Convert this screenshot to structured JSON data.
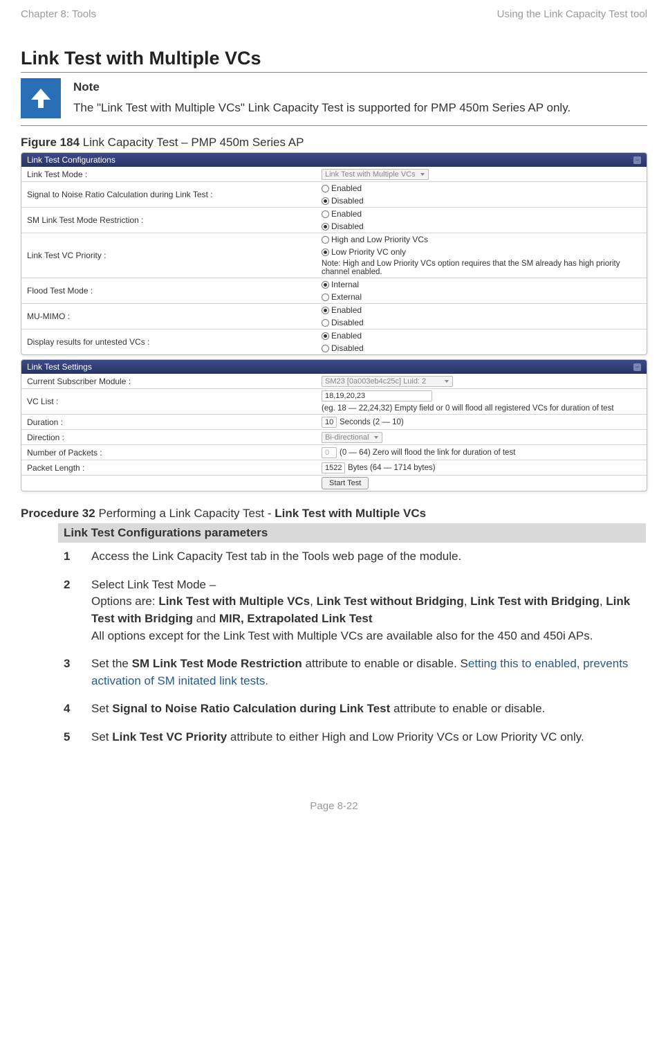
{
  "header": {
    "left": "Chapter 8:  Tools",
    "right": "Using the Link Capacity Test tool"
  },
  "main_heading": "Link Test with Multiple VCs",
  "note": {
    "label": "Note",
    "text": "The \"Link Test with Multiple VCs\" Link Capacity Test is supported for PMP 450m Series AP only."
  },
  "figure": {
    "label": "Figure 184",
    "text": " Link Capacity Test – PMP 450m Series AP"
  },
  "panels": {
    "config_title": "Link Test Configurations",
    "settings_title": "Link Test Settings",
    "config": {
      "link_test_mode_lbl": "Link Test Mode :",
      "link_test_mode_val": "Link Test with Multiple VCs",
      "snr_lbl": "Signal to Noise Ratio Calculation during Link Test :",
      "snr_en": "Enabled",
      "snr_dis": "Disabled",
      "sm_restrict_lbl": "SM Link Test Mode Restriction :",
      "sm_en": "Enabled",
      "sm_dis": "Disabled",
      "vc_prio_lbl": "Link Test VC Priority :",
      "vc_prio_opt1": "High and Low Priority VCs",
      "vc_prio_opt2": "Low Priority VC only",
      "vc_prio_note": "Note: High and Low Priority VCs option requires that the SM already has high priority channel enabled.",
      "flood_lbl": "Flood Test Mode :",
      "flood_int": "Internal",
      "flood_ext": "External",
      "mumimo_lbl": "MU-MIMO :",
      "mumimo_en": "Enabled",
      "mumimo_dis": "Disabled",
      "display_lbl": "Display results for untested VCs :",
      "display_en": "Enabled",
      "display_dis": "Disabled"
    },
    "settings": {
      "csm_lbl": "Current Subscriber Module :",
      "csm_val": "SM23 [0a003eb4c25c] Luid: 2",
      "vclist_lbl": "VC List :",
      "vclist_val": "18,19,20,23",
      "vclist_hint": "(eg. 18 — 22,24,32) Empty field or 0 will flood all registered VCs for duration of test",
      "dur_lbl": "Duration :",
      "dur_val": "10",
      "dur_hint": "Seconds (2 — 10)",
      "dir_lbl": "Direction :",
      "dir_val": "Bi-directional",
      "pkts_lbl": "Number of Packets :",
      "pkts_val": "0",
      "pkts_hint": "(0 — 64) Zero will flood the link for duration of test",
      "plen_lbl": "Packet Length :",
      "plen_val": "1522",
      "plen_hint": "Bytes (64 — 1714 bytes)",
      "start_btn": "Start Test"
    }
  },
  "procedure": {
    "label": "Procedure 32",
    "text_plain": " Performing a Link Capacity Test - ",
    "text_bold": "Link Test with Multiple VCs",
    "section_head": "Link Test Configurations parameters",
    "steps": {
      "s1": "Access the Link Capacity Test tab in the Tools web page of the module.",
      "s2_a": "Select Link Test Mode –",
      "s2_b_pre": "Options are: ",
      "s2_b_opts": "Link Test with Multiple VCs",
      "s2_b_sep1": ", ",
      "s2_b_opt2": "Link Test without Bridging",
      "s2_b_sep2": ", ",
      "s2_b_opt3": "Link Test with Bridging",
      "s2_b_sep3": ", ",
      "s2_b_opt4": "Link Test with Bridging",
      "s2_b_and": " and ",
      "s2_b_opt5": "MIR, Extrapolated Link Test",
      "s2_c": "All options except for the Link Test with Multiple VCs are available also for the 450 and 450i APs.",
      "s3_a": "Set the ",
      "s3_bold": "SM Link Test Mode Restriction",
      "s3_b": " attribute to enable or disable. S",
      "s3_c": "etting this to enabled, prevents activation of SM initated link tests.",
      "s4_a": "Set ",
      "s4_bold": "Signal to Noise Ratio Calculation during Link Test",
      "s4_b": " attribute to enable or disable.",
      "s5_a": "Set ",
      "s5_bold": "Link Test VC Priority",
      "s5_b": " attribute to either High and Low Priority VCs or Low Priority VC only."
    }
  },
  "page_number": "Page 8-22"
}
